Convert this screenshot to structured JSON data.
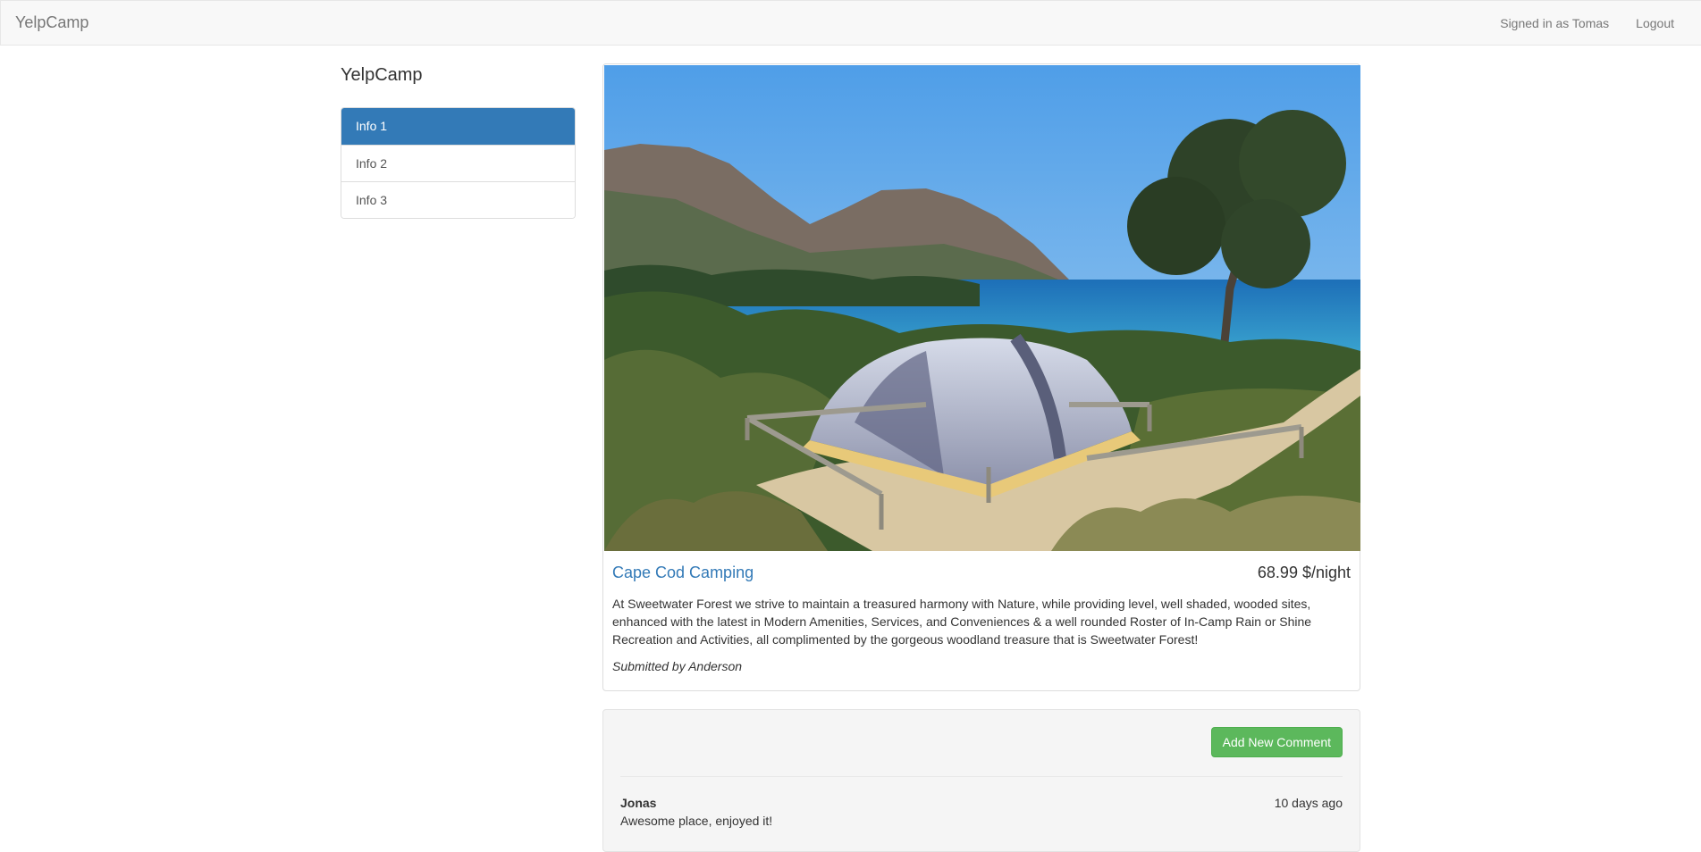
{
  "navbar": {
    "brand": "YelpCamp",
    "signed_in": "Signed in as Tomas",
    "logout": "Logout"
  },
  "sidebar": {
    "title": "YelpCamp",
    "items": [
      {
        "label": "Info 1",
        "active": true
      },
      {
        "label": "Info 2",
        "active": false
      },
      {
        "label": "Info 3",
        "active": false
      }
    ]
  },
  "campground": {
    "name": "Cape Cod Camping",
    "price": "68.99 $/night",
    "description": "At Sweetwater Forest we strive to maintain a treasured harmony with Nature, while providing level, well shaded, wooded sites, enhanced with the latest in Modern Amenities, Services, and Conveniences & a well rounded Roster of In-Camp Rain or Shine Recreation and Activities, all complimented by the gorgeous woodland treasure that is Sweetwater Forest!",
    "submitted_by": "Submitted by Anderson"
  },
  "comments": {
    "add_button": "Add New Comment",
    "items": [
      {
        "author": "Jonas",
        "date": "10 days ago",
        "text": "Awesome place, enjoyed it!"
      }
    ]
  },
  "colors": {
    "primary": "#337ab7",
    "success": "#5cb85c",
    "navbar_bg": "#f8f8f8"
  }
}
